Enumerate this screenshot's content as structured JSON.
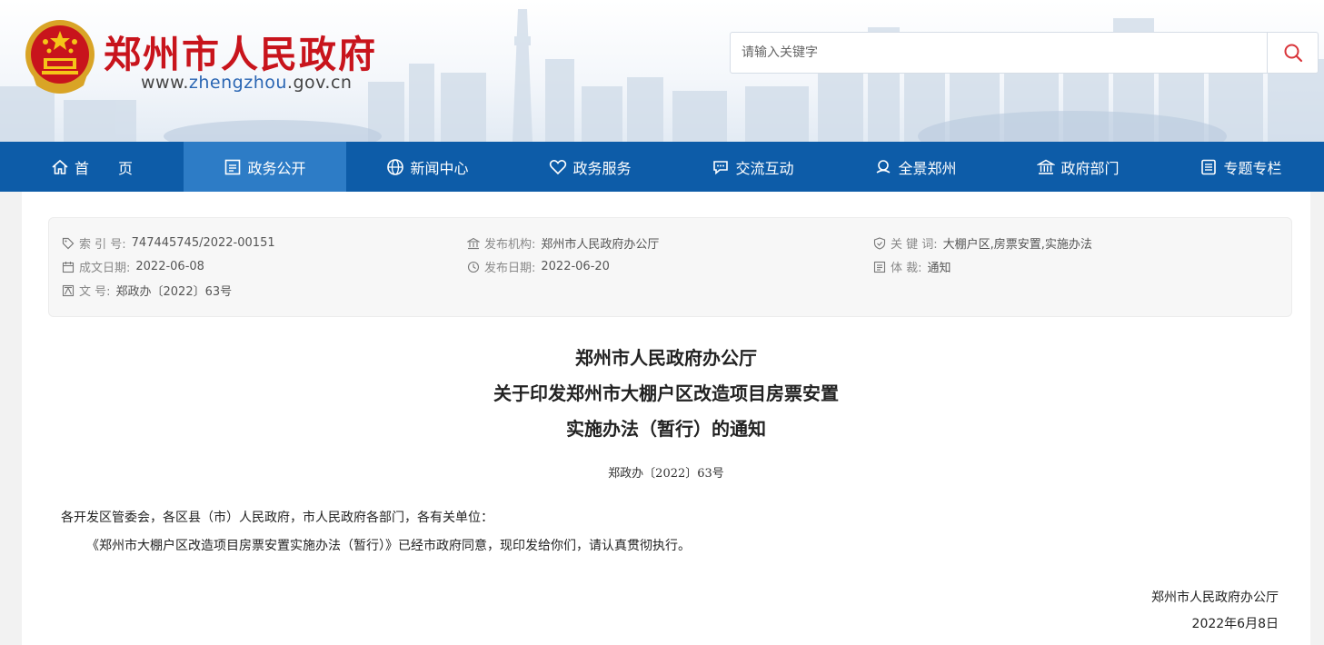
{
  "header": {
    "site_title": "郑州市人民政府",
    "url_prefix": "www.",
    "url_highlight": "zhengzhou",
    "url_suffix": ".gov.cn",
    "search_placeholder": "请输入关键字",
    "title_color": "#c8141c"
  },
  "nav": {
    "bg_color": "#0d5ca8",
    "active_color": "#2d7cc6",
    "items": [
      {
        "label": "首　　页",
        "icon": "home-icon"
      },
      {
        "label": "政务公开",
        "icon": "bulletin-icon",
        "active": true
      },
      {
        "label": "新闻中心",
        "icon": "globe-icon"
      },
      {
        "label": "政务服务",
        "icon": "heart-icon"
      },
      {
        "label": "交流互动",
        "icon": "chat-icon"
      },
      {
        "label": "全景郑州",
        "icon": "panorama-icon"
      },
      {
        "label": "政府部门",
        "icon": "building-icon"
      },
      {
        "label": "专题专栏",
        "icon": "topic-icon"
      }
    ]
  },
  "meta": {
    "index": {
      "label": "索  引  号:",
      "value": "747445745/2022-00151",
      "icon": "tag-icon"
    },
    "issuer": {
      "label": "发布机构:",
      "value": "郑州市人民政府办公厅",
      "icon": "institution-icon"
    },
    "keywords": {
      "label": "关  键  词:",
      "value": "大棚户区,房票安置,实施办法",
      "icon": "shield-icon"
    },
    "written_date": {
      "label": "成文日期:",
      "value": "2022-06-08",
      "icon": "calendar-icon"
    },
    "publish_date": {
      "label": "发布日期:",
      "value": "2022-06-20",
      "icon": "clock-icon"
    },
    "genre": {
      "label": "体        裁:",
      "value": "通知",
      "icon": "list-icon"
    },
    "doc_no": {
      "label": "文        号:",
      "value": "郑政办〔2022〕63号",
      "icon": "document-icon"
    }
  },
  "document": {
    "title_line1": "郑州市人民政府办公厅",
    "title_line2": "关于印发郑州市大棚户区改造项目房票安置",
    "title_line3": "实施办法（暂行）的通知",
    "number": "郑政办〔2022〕63号",
    "salutation": "各开发区管委会，各区县（市）人民政府，市人民政府各部门，各有关单位：",
    "body": "《郑州市大棚户区改造项目房票安置实施办法（暂行）》已经市政府同意，现印发给你们，请认真贯彻执行。",
    "signature": "郑州市人民政府办公厅",
    "date": "2022年6月8日"
  }
}
